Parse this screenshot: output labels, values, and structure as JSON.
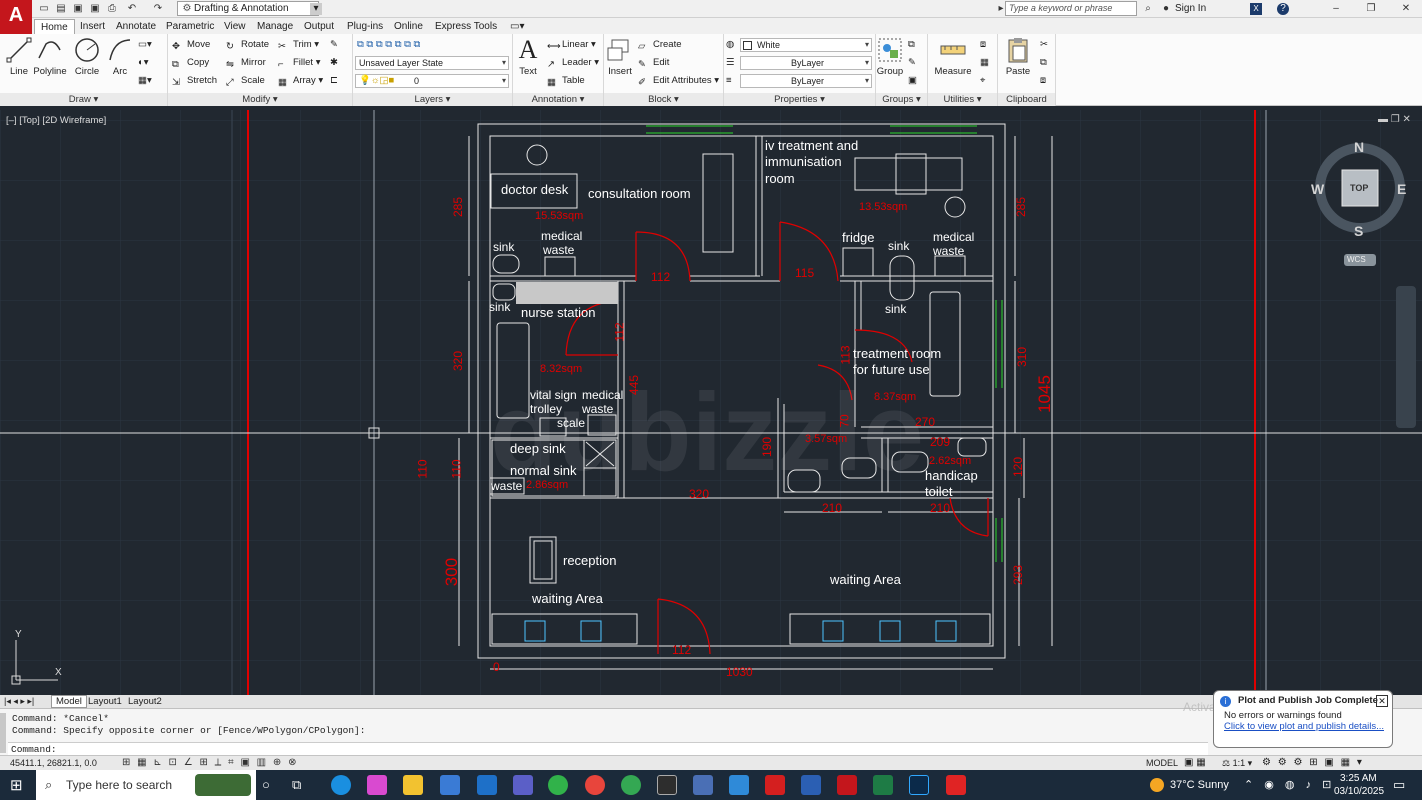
{
  "window": {
    "workspace": "Drafting & Annotation",
    "search_placeholder": "Type a keyword or phrase",
    "sign_in": "Sign In"
  },
  "tabs": [
    "Home",
    "Insert",
    "Annotate",
    "Parametric",
    "View",
    "Manage",
    "Output",
    "Plug-ins",
    "Online",
    "Express Tools"
  ],
  "active_tab": "Home",
  "ribbon": {
    "draw": {
      "title": "Draw",
      "tools": [
        "Line",
        "Polyline",
        "Circle",
        "Arc"
      ]
    },
    "modify": {
      "title": "Modify",
      "tools": [
        "Move",
        "Rotate",
        "Trim",
        "Copy",
        "Mirror",
        "Fillet",
        "Stretch",
        "Scale",
        "Array"
      ]
    },
    "layers": {
      "title": "Layers",
      "layer_state": "Unsaved Layer State",
      "current_layer": "0"
    },
    "annotation": {
      "title": "Annotation",
      "big": "Text",
      "tools": [
        "Linear",
        "Leader",
        "Table"
      ]
    },
    "block": {
      "title": "Block",
      "big": "Insert",
      "tools": [
        "Create",
        "Edit",
        "Edit Attributes"
      ]
    },
    "properties": {
      "title": "Properties",
      "color": "White",
      "linetype": "ByLayer",
      "lineweight": "ByLayer"
    },
    "groups": {
      "title": "Groups",
      "big": "Group"
    },
    "utilities": {
      "title": "Utilities",
      "big": "Measure"
    },
    "clipboard": {
      "title": "Clipboard",
      "big": "Paste"
    }
  },
  "viewport_label": "[–] [Top] [2D Wireframe]",
  "viewcube": {
    "top": "TOP",
    "n": "N",
    "s": "S",
    "e": "E",
    "w": "W",
    "wcs": "WCS"
  },
  "ucs": {
    "x": "X",
    "y": "Y"
  },
  "plan": {
    "rooms": {
      "consultation": "consultation room",
      "doctor_desk": "doctor desk",
      "consult_area": "15.53sqm",
      "iv_1": "iv treatment and",
      "iv_2": "immunisation",
      "iv_3": "room",
      "iv_area": "13.53sqm",
      "sink_a": "sink",
      "med_waste_a1": "medical",
      "med_waste_a2": "waste",
      "fridge": "fridge",
      "sink_b": "sink",
      "med_waste_b1": "medical",
      "med_waste_b2": "waste",
      "sink_c": "sink",
      "nurse_station": "nurse station",
      "sink_d": "sink",
      "nurse_area": "8.32sqm",
      "vital_1": "vital sign",
      "vital_2": "trolley",
      "scale": "scale",
      "med_waste_c1": "medical",
      "med_waste_c2": "waste",
      "treat_1": "treatment room",
      "treat_2": "for future use",
      "treat_area": "8.37sqm",
      "deep_sink": "deep sink",
      "normal_sink": "normal sink",
      "waste": "waste",
      "util_area": "2.86sqm",
      "wc_area": "3.57sqm",
      "hc_area": "2.62sqm",
      "handicap": "handicap",
      "toilet": "toilet",
      "reception": "reception",
      "waiting_a": "waiting Area",
      "waiting_b": "waiting Area"
    },
    "dims": {
      "d285a": "285",
      "d285b": "285",
      "d320": "320",
      "d310": "310",
      "d1045": "1045",
      "d110a": "110",
      "d110b": "110",
      "d120": "120",
      "d300": "300",
      "d293": "293",
      "d112a": "112",
      "d115": "115",
      "d112b": "112",
      "d445": "445",
      "d113": "113",
      "d70": "70",
      "d270": "270",
      "d190": "190",
      "d209": "209",
      "d320b": "320",
      "d210a": "210",
      "d210b": "210",
      "d112c": "112",
      "d1030": "1030",
      "d0": "0"
    }
  },
  "layout_tabs": [
    "Model",
    "Layout1",
    "Layout2"
  ],
  "command": {
    "line1": "Command: *Cancel*",
    "line2": "Command: Specify opposite corner or [Fence/WPolygon/CPolygon]:",
    "prompt": "Command:"
  },
  "status": {
    "coords": "45411.1, 26821.1, 0.0",
    "model": "MODEL",
    "scale": "1:1"
  },
  "notification": {
    "title": "Plot and Publish Job Complete",
    "body": "No errors or warnings found",
    "link": "Click to view plot and publish details...",
    "watermark": "Activate Windows"
  },
  "taskbar": {
    "search": "Type here to search",
    "weather": "37°C  Sunny",
    "time": "3:25 AM",
    "date": "03/10/2025"
  }
}
